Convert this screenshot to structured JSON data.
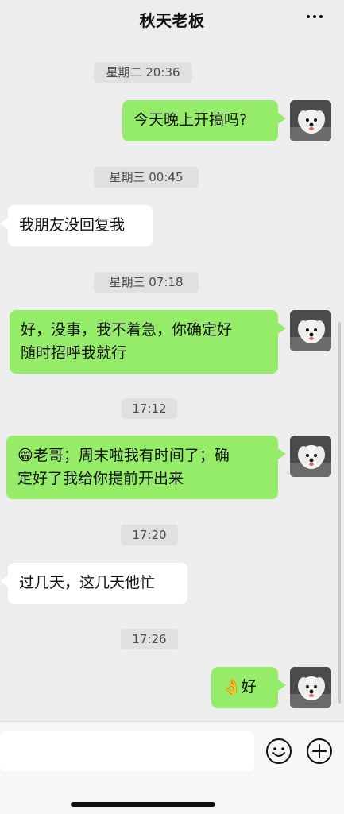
{
  "header": {
    "title": "秋天老板"
  },
  "messages": [
    {
      "type": "time",
      "text": "星期二 20:36"
    },
    {
      "type": "me",
      "text": "今天晚上开搞吗?"
    },
    {
      "type": "time",
      "text": "星期三 00:45"
    },
    {
      "type": "them",
      "text": "我朋友没回复我"
    },
    {
      "type": "time",
      "text": "星期三 07:18"
    },
    {
      "type": "me",
      "line1": "好，没事，我不着急，你确定好",
      "line2": "随时招呼我就行"
    },
    {
      "type": "time",
      "text": "17:12"
    },
    {
      "type": "me",
      "emoji": "😁",
      "line1": "老哥；周末啦我有时间了；确",
      "line2": "定好了我给你提前开出来"
    },
    {
      "type": "time",
      "text": "17:20"
    },
    {
      "type": "them",
      "text": "过几天，这几天他忙"
    },
    {
      "type": "time",
      "text": "17:26"
    },
    {
      "type": "me",
      "emoji": "👌",
      "text": "好"
    }
  ],
  "colors": {
    "background": "#ededed",
    "my_bubble": "#95ec69",
    "their_bubble": "#ffffff"
  },
  "icons": {
    "more": "more-icon",
    "avatar": "dog-avatar",
    "emoji_button": "smiley-icon",
    "plus_button": "plus-icon"
  }
}
